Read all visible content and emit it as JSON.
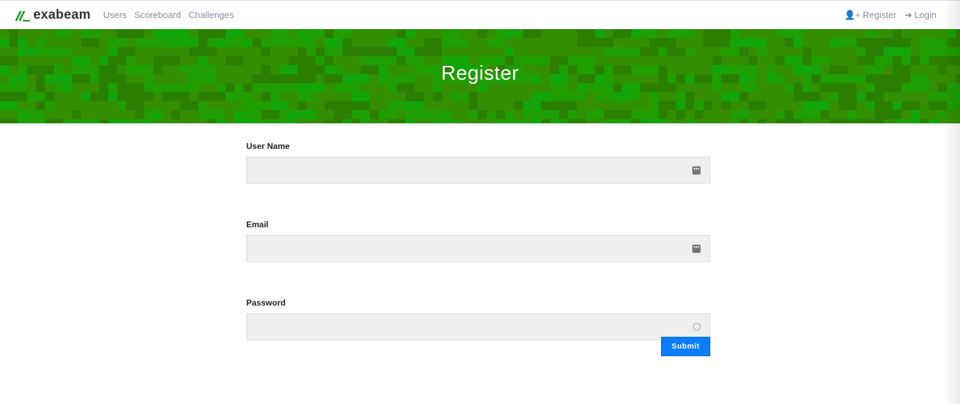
{
  "brand": {
    "name": "exabeam",
    "color": "#1a9c1a"
  },
  "nav": {
    "links": [
      "Users",
      "Scoreboard",
      "Challenges"
    ],
    "register": "Register",
    "login": "Login"
  },
  "banner": {
    "title": "Register",
    "colors": [
      "#338f00",
      "#1f9e00",
      "#2b7f00",
      "#12a50a"
    ]
  },
  "form": {
    "username_label": "User Name",
    "email_label": "Email",
    "password_label": "Password",
    "submit": "Submit",
    "username": "",
    "email": "",
    "password": ""
  },
  "accent": "#0a7cff"
}
